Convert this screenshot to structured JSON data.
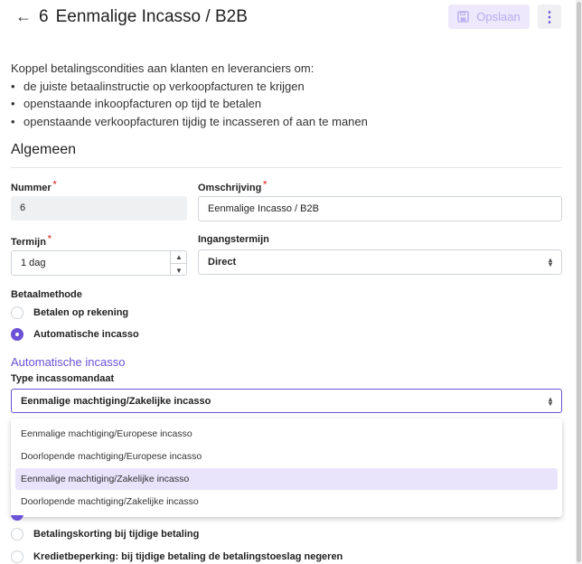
{
  "header": {
    "number": "6",
    "title": "Eenmalige Incasso / B2B",
    "save_label": "Opslaan",
    "back_icon": "arrow-left-icon",
    "more_icon": "kebab-menu-icon"
  },
  "intro": {
    "text": "Koppel betalingscondities aan klanten en leveranciers om:",
    "bullets": [
      "de juiste betaalinstructie op verkoopfacturen te krijgen",
      "openstaande inkoopfacturen op tijd te betalen",
      "openstaande verkoopfacturen tijdig te incasseren of aan te manen"
    ]
  },
  "general": {
    "title": "Algemeen",
    "number_label": "Nummer",
    "number_value": "6",
    "description_label": "Omschrijving",
    "description_value": "Eenmalige Incasso / B2B",
    "term_label": "Termijn",
    "term_value": "1 dag",
    "start_term_label": "Ingangstermijn",
    "start_term_value": "Direct",
    "required_mark": "*"
  },
  "payment_method": {
    "label": "Betaalmethode",
    "options": [
      {
        "label": "Betalen op rekening",
        "checked": false
      },
      {
        "label": "Automatische incasso",
        "checked": true
      }
    ]
  },
  "direct_debit": {
    "title": "Automatische incasso",
    "type_label": "Type incassomandaat",
    "type_value": "Eenmalige machtiging/Zakelijke incasso",
    "options": [
      {
        "label": "Eenmalige machtiging/Europese incasso",
        "selected": false
      },
      {
        "label": "Doorlopende machtiging/Europese incasso",
        "selected": false
      },
      {
        "label": "Eenmalige machtiging/Zakelijke incasso",
        "selected": true
      },
      {
        "label": "Doorlopende machtiging/Zakelijke incasso",
        "selected": false
      }
    ]
  },
  "extra_options": [
    {
      "label": "Betalingskorting bij tijdige betaling",
      "checked": false
    },
    {
      "label": "Kredietbeperking: bij tijdige betaling de betalingstoeslag negeren",
      "checked": false
    }
  ],
  "colors": {
    "accent": "#6b52d6",
    "required": "#e0473b",
    "selected_option_bg": "#e9e3fb"
  }
}
